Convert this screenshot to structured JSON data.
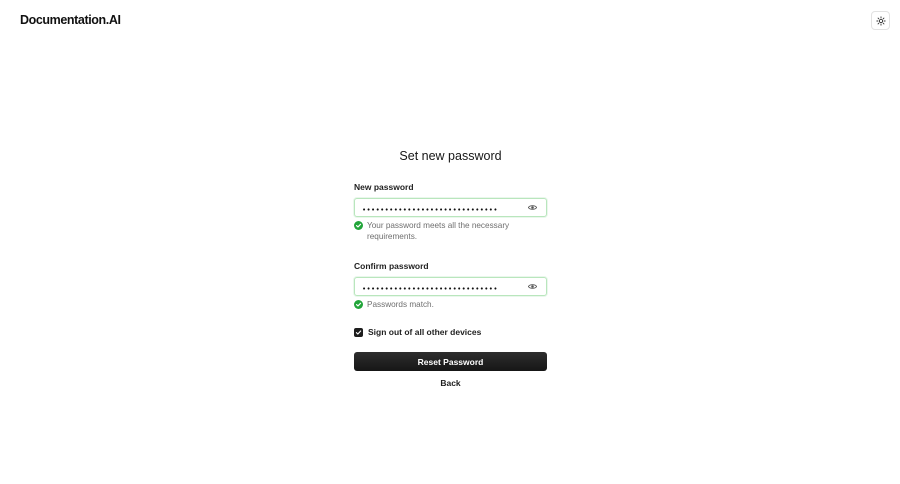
{
  "header": {
    "logo_text": "Documentation.AI",
    "theme_toggle_icon": "sun-icon"
  },
  "form": {
    "title": "Set new password",
    "new_password": {
      "label": "New password",
      "value": "••••••••••••••••••••••••••••••",
      "toggle_icon": "eye-icon",
      "hint": "Your password meets all the necessary requirements."
    },
    "confirm_password": {
      "label": "Confirm password",
      "value": "••••••••••••••••••••••••••••••",
      "toggle_icon": "eye-icon",
      "hint": "Passwords match."
    },
    "sign_out_checkbox": {
      "label": "Sign out of all other devices",
      "checked": true
    },
    "submit_label": "Reset Password",
    "back_label": "Back"
  },
  "colors": {
    "success": "#22a53a",
    "valid_border": "#b9e6bd",
    "primary_button": "#1c1c1c"
  }
}
